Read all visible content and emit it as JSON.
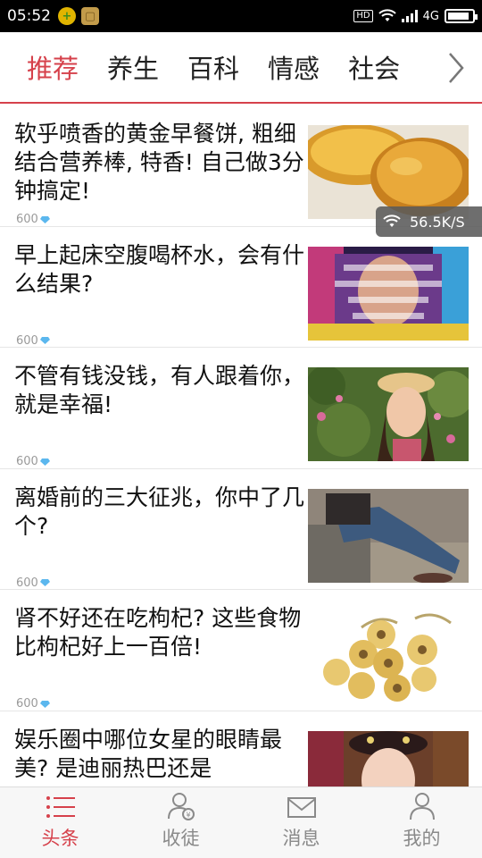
{
  "statusbar": {
    "time": "05:52",
    "hd": "HD",
    "network": "4G",
    "battery_level": 0.9
  },
  "tabs": [
    {
      "label": "推荐",
      "active": true
    },
    {
      "label": "养生"
    },
    {
      "label": "百科"
    },
    {
      "label": "情感"
    },
    {
      "label": "社会"
    }
  ],
  "feed": [
    {
      "title": "软乎喷香的黄金早餐饼, 粗细结合营养棒, 特香! 自己做3分钟搞定!",
      "count": "600",
      "image": "golden-pancake-photo"
    },
    {
      "title": "早上起床空腹喝杯水，会有什么结果?",
      "count": "600",
      "image": "tv-show-screenshot"
    },
    {
      "title": "不管有钱没钱，有人跟着你，就是幸福!",
      "count": "600",
      "image": "woman-with-hat-photo"
    },
    {
      "title": "离婚前的三大征兆，你中了几个?",
      "count": "600",
      "image": "person-sitting-jeans-photo"
    },
    {
      "title": "肾不好还在吃枸杞? 这些食物比枸杞好上一百倍!",
      "count": "600",
      "image": "maca-roots-photo"
    },
    {
      "title": "娱乐圈中哪位女星的眼睛最美? 是迪丽热巴还是",
      "count": "",
      "image": "actress-costume-photo"
    }
  ],
  "speed_overlay": "56.5K/S",
  "bottom_nav": [
    {
      "label": "头条",
      "icon": "list-icon",
      "active": true
    },
    {
      "label": "收徒",
      "icon": "user-coin-icon"
    },
    {
      "label": "消息",
      "icon": "mail-icon"
    },
    {
      "label": "我的",
      "icon": "person-icon"
    }
  ],
  "colors": {
    "accent": "#d6414b"
  }
}
